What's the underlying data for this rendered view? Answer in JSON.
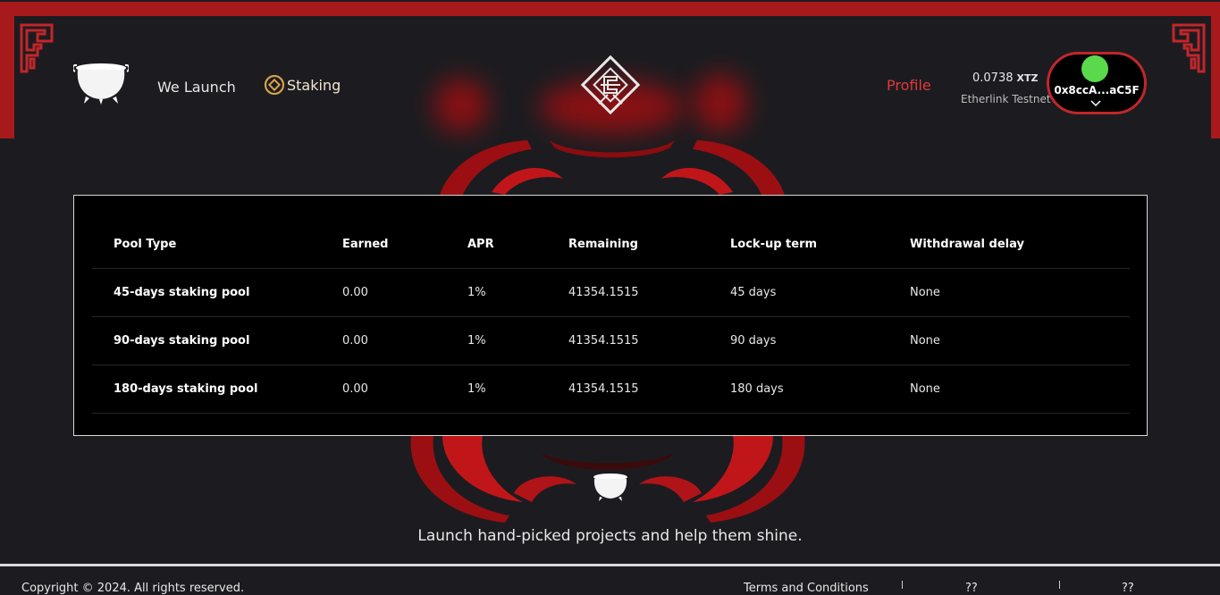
{
  "nav": {
    "we_launch": "We Launch",
    "staking": "Staking",
    "profile": "Profile"
  },
  "wallet": {
    "balance": "0.0738",
    "unit": "XTZ",
    "network": "Etherlink Testnet",
    "address": "0x8ccA...aC5F",
    "avatar_color": "#59d94b"
  },
  "table": {
    "headers": [
      "Pool Type",
      "Earned",
      "APR",
      "Remaining",
      "Lock-up term",
      "Withdrawal delay"
    ],
    "rows": [
      [
        "45-days staking pool",
        "0.00",
        "1%",
        "41354.1515",
        "45 days",
        "None"
      ],
      [
        "90-days staking pool",
        "0.00",
        "1%",
        "41354.1515",
        "90 days",
        "None"
      ],
      [
        "180-days staking pool",
        "0.00",
        "1%",
        "41354.1515",
        "180 days",
        "None"
      ]
    ]
  },
  "footer": {
    "tagline": "Launch hand-picked projects and help them shine.",
    "copyright": "Copyright © 2024. All rights reserved.",
    "terms": "Terms and Conditions",
    "link2": "??",
    "link3": "??"
  },
  "colors": {
    "brand_red": "#a8191b",
    "accent_red": "#e0393b",
    "background": "#1c1c20"
  },
  "icons": {
    "logo": "cauldron-icon",
    "staking": "coin-icon",
    "emblem": "knot-emblem-icon",
    "wallet_dropdown": "chevron-down-icon"
  }
}
